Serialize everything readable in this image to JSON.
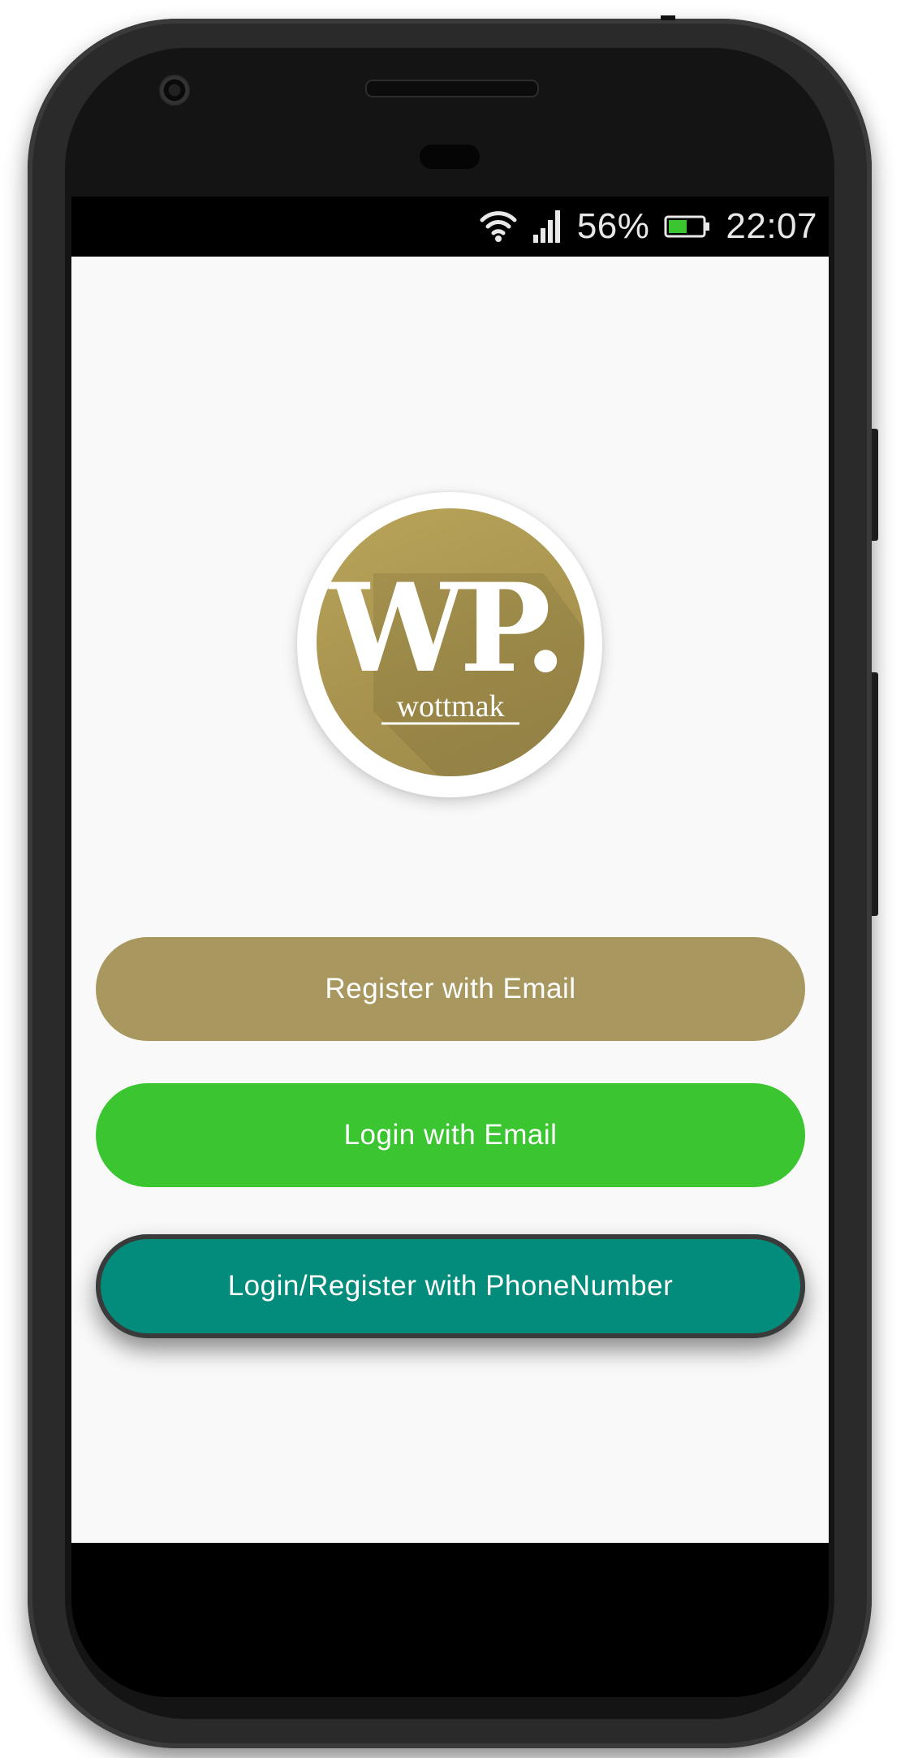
{
  "status_bar": {
    "battery_percent": "56%",
    "time": "22:07",
    "icons": [
      "wifi-icon",
      "signal-icon",
      "battery-icon"
    ],
    "battery_level": 0.56
  },
  "logo": {
    "monogram": "WP.",
    "wordmark": "wottmak",
    "colors": {
      "disc": "#a8944f",
      "ring": "#ffffff"
    }
  },
  "buttons": {
    "register_email": {
      "label": "Register with Email",
      "color": "#a8985f"
    },
    "login_email": {
      "label": "Login with Email",
      "color": "#3ac531"
    },
    "phone": {
      "label": "Login/Register with PhoneNumber",
      "color": "#038b7c"
    }
  }
}
